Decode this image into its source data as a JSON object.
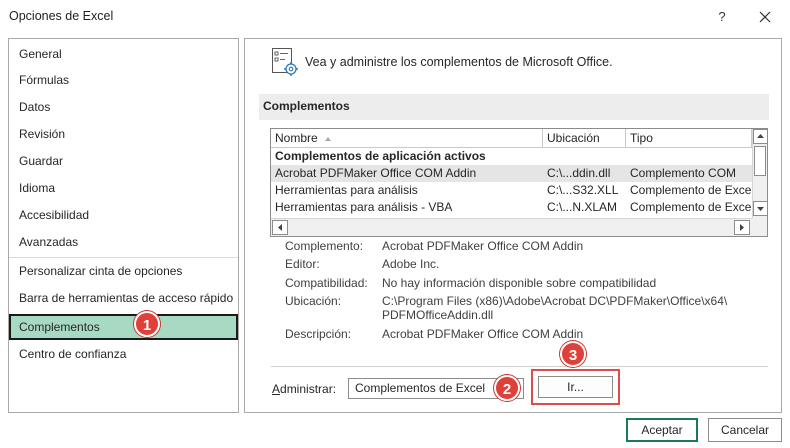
{
  "window": {
    "title": "Opciones de Excel",
    "help_label": "?"
  },
  "sidebar": {
    "items": [
      {
        "label": "General"
      },
      {
        "label": "Fórmulas"
      },
      {
        "label": "Datos"
      },
      {
        "label": "Revisión"
      },
      {
        "label": "Guardar"
      },
      {
        "label": "Idioma"
      },
      {
        "label": "Accesibilidad"
      },
      {
        "label": "Avanzadas"
      },
      {
        "label": "Personalizar cinta de opciones"
      },
      {
        "label": "Barra de herramientas de acceso rápido"
      },
      {
        "label": "Complementos",
        "selected": true
      },
      {
        "label": "Centro de confianza"
      }
    ]
  },
  "main": {
    "header_text": "Vea y administre los complementos de Microsoft Office.",
    "section_title": "Complementos",
    "table": {
      "columns": [
        "Nombre",
        "Ubicación",
        "Tipo"
      ],
      "group_title": "Complementos de aplicación activos",
      "rows": [
        {
          "name": "Acrobat PDFMaker Office COM Addin",
          "location": "C:\\...ddin.dll",
          "type": "Complemento COM",
          "selected": true
        },
        {
          "name": "Herramientas para análisis",
          "location": "C:\\...S32.XLL",
          "type": "Complemento de Excel"
        },
        {
          "name": "Herramientas para análisis - VBA",
          "location": "C:\\...N.XLAM",
          "type": "Complemento de Excel"
        }
      ]
    },
    "details": [
      {
        "label": "Complemento:",
        "value": "Acrobat PDFMaker Office COM Addin"
      },
      {
        "label": "Editor:",
        "value": "Adobe Inc."
      },
      {
        "label": "Compatibilidad:",
        "value": "No hay información disponible sobre compatibilidad"
      },
      {
        "label": "Ubicación:",
        "value": "C:\\Program Files (x86)\\Adobe\\Acrobat DC\\PDFMaker\\Office\\x64\\",
        "value2": "PDFMOfficeAddin.dll"
      },
      {
        "label": "Descripción:",
        "value": "Acrobat PDFMaker Office COM Addin"
      }
    ],
    "manage": {
      "label_prefix": "A",
      "label_rest": "dministrar:",
      "selected_option": "Complementos de Excel",
      "go_label": "Ir..."
    }
  },
  "badges": [
    "1",
    "2",
    "3"
  ],
  "footer": {
    "ok_label": "Aceptar",
    "cancel_label": "Cancelar"
  },
  "colors": {
    "selected_nav": "#a8d9c3",
    "ok_border": "#1e7a55",
    "badge": "#e0403a",
    "highlight": "#e04a4a"
  }
}
